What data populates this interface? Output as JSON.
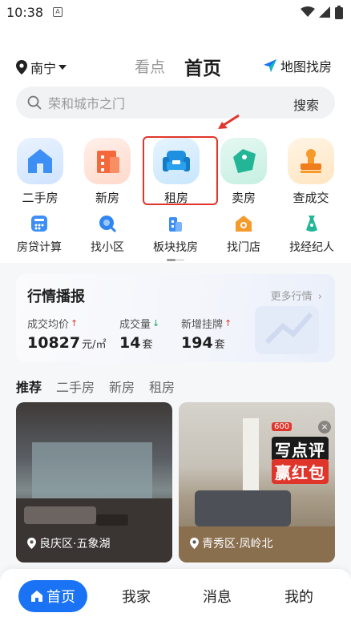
{
  "status_bar": {
    "time": "10:38",
    "notification_icon": "A"
  },
  "header": {
    "city": "南宁",
    "tabs": [
      "看点",
      "首页"
    ],
    "map_find": "地图找房",
    "search": {
      "placeholder": "荣和城市之门",
      "button": "搜索"
    }
  },
  "main_icons": [
    {
      "label": "二手房",
      "icon": "house-icon",
      "color": "#3d8ff5"
    },
    {
      "label": "新房",
      "icon": "building-icon",
      "color": "#f4693b"
    },
    {
      "label": "租房",
      "icon": "sofa-icon",
      "color": "#1f8fe0"
    },
    {
      "label": "卖房",
      "icon": "tag-icon",
      "color": "#22b596"
    },
    {
      "label": "查成交",
      "icon": "stamp-icon",
      "color": "#f59a2b"
    }
  ],
  "small_icons": [
    {
      "label": "房贷计算",
      "icon": "calculator-icon"
    },
    {
      "label": "找小区",
      "icon": "search-community-icon"
    },
    {
      "label": "板块找房",
      "icon": "blocks-icon"
    },
    {
      "label": "找门店",
      "icon": "store-icon"
    },
    {
      "label": "找经纪人",
      "icon": "agent-icon"
    }
  ],
  "market": {
    "title": "行情播报",
    "more": "更多行情",
    "stats": [
      {
        "label": "成交均价",
        "value": "10827",
        "unit": "元/㎡",
        "trend": "up"
      },
      {
        "label": "成交量",
        "value": "14",
        "unit": "套",
        "trend": "down"
      },
      {
        "label": "新增挂牌",
        "value": "194",
        "unit": "套",
        "trend": "up"
      }
    ]
  },
  "recommend_tabs": [
    "推荐",
    "二手房",
    "新房",
    "租房"
  ],
  "cards": [
    {
      "location": "良庆区·五象湖"
    },
    {
      "location": "青秀区·凤岭北",
      "promo": {
        "badge": "600",
        "line1": "写点评",
        "line2": "赢红包"
      }
    }
  ],
  "bottom_nav": [
    "首页",
    "我家",
    "消息",
    "我的"
  ],
  "colors": {
    "accent": "#1a73f5",
    "highlight": "#e0352b",
    "up": "#e0352b",
    "down": "#19a35c"
  }
}
